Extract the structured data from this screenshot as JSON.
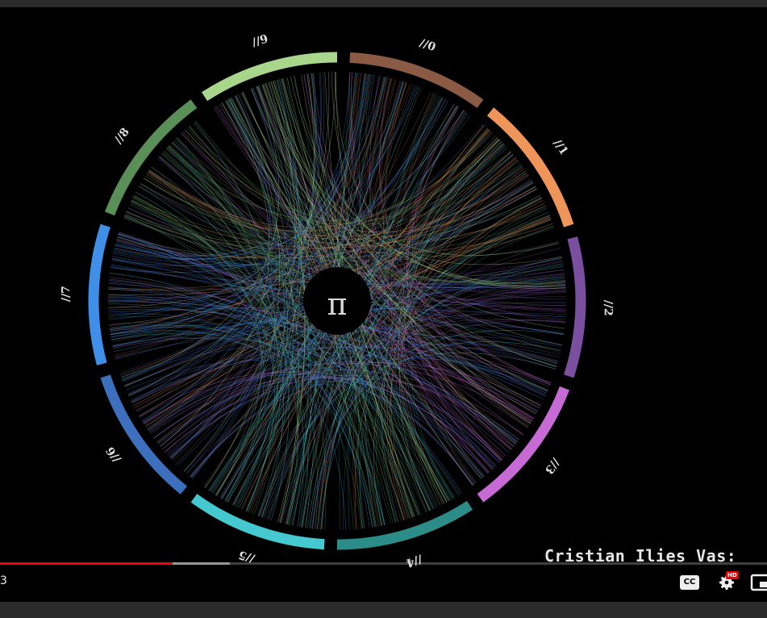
{
  "visualization": {
    "center_symbol": "π",
    "sector_labels": [
      "//0",
      "//1",
      "//2",
      "//3",
      "//4",
      "//5",
      "//6",
      "//7",
      "//8",
      "//9"
    ],
    "sector_colors": [
      "#8a5a44",
      "#f0955a",
      "#7a4fa0",
      "#c86ad6",
      "#2b8c88",
      "#45c9d0",
      "#3d6fbf",
      "#3f8fe8",
      "#5b8f58",
      "#a8d68a"
    ]
  },
  "credit": "Cristian Ilies Vas:",
  "player": {
    "time": "3",
    "progress": {
      "played_fraction": 0.225,
      "buffered_fraction": 0.3
    },
    "cc_label": "CC",
    "hd_label": "HD"
  }
}
